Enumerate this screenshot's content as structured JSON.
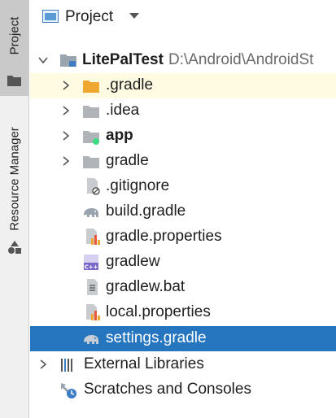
{
  "sidebar": {
    "project_tab": "Project",
    "resource_tab": "Resource Manager"
  },
  "header": {
    "title": "Project"
  },
  "tree": {
    "root": {
      "name": "LitePalTest",
      "path": "D:\\Android\\AndroidSt"
    },
    "items": [
      {
        "label": ".gradle"
      },
      {
        "label": ".idea"
      },
      {
        "label": "app"
      },
      {
        "label": "gradle"
      },
      {
        "label": ".gitignore"
      },
      {
        "label": "build.gradle"
      },
      {
        "label": "gradle.properties"
      },
      {
        "label": "gradlew"
      },
      {
        "label": "gradlew.bat"
      },
      {
        "label": "local.properties"
      },
      {
        "label": "settings.gradle"
      }
    ],
    "external_libraries": "External Libraries",
    "scratches": "Scratches and Consoles"
  },
  "colors": {
    "selection": "#2675bf",
    "highlight_row": "#fffbe3",
    "folder": "#b0b4b8",
    "excluded_folder": "#f0a732"
  }
}
